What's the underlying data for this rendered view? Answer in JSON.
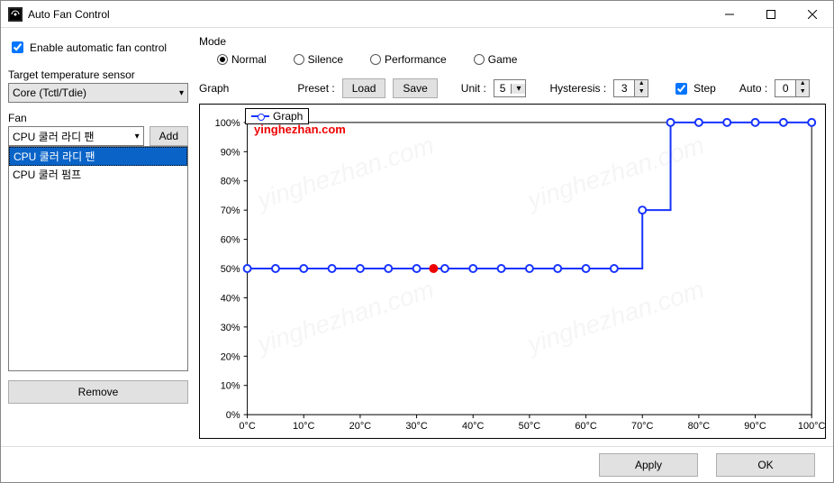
{
  "window": {
    "title": "Auto Fan Control"
  },
  "enable": {
    "label": "Enable automatic fan control",
    "checked": true
  },
  "target": {
    "label": "Target temperature sensor",
    "value": "Core (Tctl/Tdie)"
  },
  "fan": {
    "label": "Fan",
    "combo": "CPU 쿨러 라디 팬",
    "add": "Add",
    "items": [
      "CPU 쿨러 라디 팬",
      "CPU 쿨러 펌프"
    ],
    "remove": "Remove"
  },
  "mode": {
    "label": "Mode",
    "options": [
      "Normal",
      "Silence",
      "Performance",
      "Game"
    ],
    "selected": "Normal"
  },
  "graphctrl": {
    "graph": "Graph",
    "preset": "Preset :",
    "load": "Load",
    "save": "Save",
    "unit": "Unit :",
    "unit_val": "5",
    "hyst": "Hysteresis :",
    "hyst_val": "3",
    "step": "Step",
    "step_chk": true,
    "auto": "Auto :",
    "auto_val": "0"
  },
  "legend": "Graph",
  "watermark": "yinghezhan.com",
  "footer": {
    "apply": "Apply",
    "ok": "OK"
  },
  "chart_data": {
    "type": "line",
    "title": "Graph",
    "xlabel": "",
    "ylabel": "",
    "xlim": [
      0,
      100
    ],
    "ylim": [
      0,
      100
    ],
    "x_ticks": [
      "0°C",
      "10°C",
      "20°C",
      "30°C",
      "40°C",
      "50°C",
      "60°C",
      "70°C",
      "80°C",
      "90°C",
      "100°C"
    ],
    "y_ticks": [
      "0%",
      "10%",
      "20%",
      "30%",
      "40%",
      "50%",
      "60%",
      "70%",
      "80%",
      "90%",
      "100%"
    ],
    "series": [
      {
        "name": "Graph",
        "x": [
          0,
          5,
          10,
          15,
          20,
          25,
          30,
          35,
          40,
          45,
          50,
          55,
          60,
          65,
          70,
          75,
          80,
          85,
          90,
          95,
          100
        ],
        "values": [
          50,
          50,
          50,
          50,
          50,
          50,
          50,
          50,
          50,
          50,
          50,
          50,
          50,
          50,
          70,
          100,
          100,
          100,
          100,
          100,
          100
        ]
      }
    ],
    "current_point": {
      "x": 33,
      "y": 50
    },
    "step": true
  }
}
